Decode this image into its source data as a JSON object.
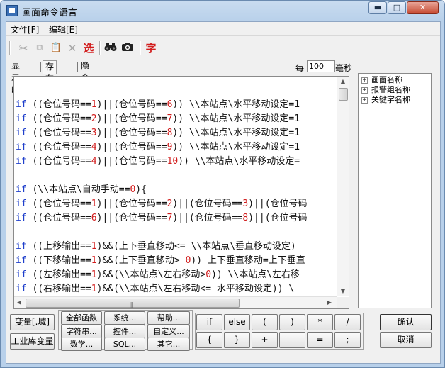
{
  "window": {
    "title": "画面命令语言",
    "controls": {
      "minimize": "▬",
      "maximize": "□",
      "close": "✕"
    }
  },
  "menu": {
    "items": [
      "文件[F]",
      "编辑[E]"
    ]
  },
  "toolbar": {
    "select_label": "选",
    "char_label": "字",
    "icons": [
      "cut-icon",
      "copy-icon",
      "paste-icon",
      "delete-icon",
      "select-icon",
      "find-icon",
      "replace-icon",
      "font-icon"
    ]
  },
  "tabs": [
    "显示时",
    "存在时",
    "隐含时"
  ],
  "active_tab": "存在时",
  "interval": {
    "every_label": "每",
    "value": "100",
    "unit_label": "毫秒"
  },
  "code_lines": [
    "",
    "if ((仓位号码==1)||(仓位号码==6)) \\\\本站点\\水平移动设定=1",
    "if ((仓位号码==2)||(仓位号码==7)) \\\\本站点\\水平移动设定=1",
    "if ((仓位号码==3)||(仓位号码==8)) \\\\本站点\\水平移动设定=1",
    "if ((仓位号码==4)||(仓位号码==9)) \\\\本站点\\水平移动设定=1",
    "if ((仓位号码==4)||(仓位号码==10)) \\\\本站点\\水平移动设定=",
    "",
    "if (\\\\本站点\\自动手动==0){",
    "if ((仓位号码==1)||(仓位号码==2)||(仓位号码==3)||(仓位号码",
    "if ((仓位号码==6)||(仓位号码==7)||(仓位号码==8)||(仓位号码",
    "",
    "if ((上移输出==1)&&(上下垂直移动<= \\\\本站点\\垂直移动设定)",
    "if ((下移输出==1)&&(上下垂直移动> 0)) 上下垂直移动=上下垂直",
    "if ((左移输出==1)&&(\\\\本站点\\左右移动>0)) \\\\本站点\\左右移",
    "if ((右移输出==1)&&(\\\\本站点\\左右移动<= 水平移动设定)) \\"
  ],
  "tree": {
    "items": [
      "画面名称",
      "报警组名称",
      "关键字名称"
    ]
  },
  "bottom_left": {
    "var_button": "变量[.域]",
    "lib_button": "工业库变量"
  },
  "function_buttons": [
    [
      "全部函数",
      "系统...",
      "帮助..."
    ],
    [
      "字符串...",
      "控件...",
      "自定义..."
    ],
    [
      "数学...",
      "SQL...",
      "其它..."
    ]
  ],
  "operator_buttons": [
    [
      "if",
      "else",
      "(",
      ")",
      "*",
      "/"
    ],
    [
      "{",
      "}",
      "+",
      "-",
      "=",
      ";"
    ]
  ],
  "dialog_buttons": {
    "ok": "确认",
    "cancel": "取消"
  }
}
